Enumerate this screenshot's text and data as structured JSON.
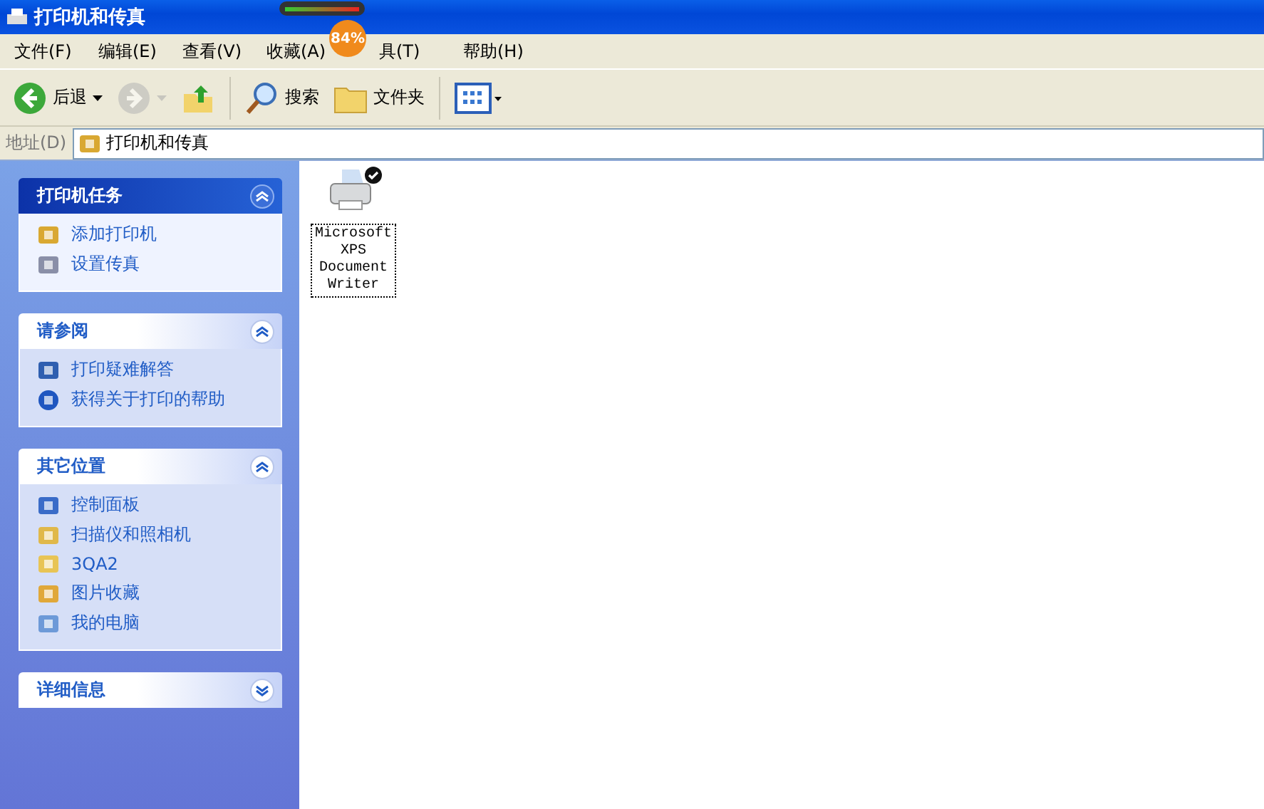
{
  "window": {
    "title": "打印机和传真"
  },
  "menu": [
    "文件(F)",
    "编辑(E)",
    "查看(V)",
    "收藏(A)",
    "具(T)",
    "帮助(H)"
  ],
  "floating_meter": {
    "reading": "84%"
  },
  "toolbar": [
    {
      "kind": "back",
      "label": "后退",
      "disabled": false
    },
    {
      "kind": "forward",
      "disabled": true
    },
    {
      "kind": "up",
      "disabled": false
    },
    {
      "kind": "search",
      "label": "搜索",
      "disabled": false
    },
    {
      "kind": "folders",
      "label": "文件夹",
      "disabled": false
    },
    {
      "kind": "views",
      "disabled": false
    }
  ],
  "address": {
    "label": "地址(D)",
    "value": "打印机和传真"
  },
  "panels": [
    {
      "title": "打印机任务",
      "kind": "special",
      "expanded": true,
      "items": [
        "添加打印机",
        "设置传真"
      ]
    },
    {
      "title": "请参阅",
      "kind": "normal",
      "expanded": true,
      "items": [
        "打印疑难解答",
        "获得关于打印的帮助"
      ]
    },
    {
      "title": "其它位置",
      "kind": "normal",
      "expanded": true,
      "items": [
        "控制面板",
        "扫描仪和照相机",
        "3QA2",
        "图片收藏",
        "我的电脑"
      ]
    },
    {
      "title": "详细信息",
      "kind": "normal",
      "expanded": false
    }
  ],
  "printers": [
    {
      "name": "Microsoft XPS Document Writer",
      "default": true,
      "selected": true
    }
  ]
}
